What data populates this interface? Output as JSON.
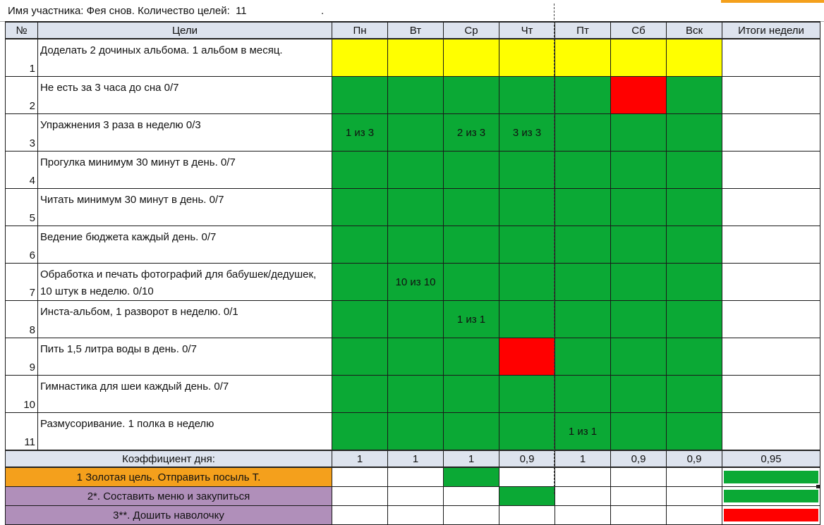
{
  "header": {
    "text": "Имя участника: Фея снов. Количество целей:  11",
    "dot": "."
  },
  "columns": [
    "№",
    "Цели",
    "Пн",
    "Вт",
    "Ср",
    "Чт",
    "Пт",
    "Сб",
    "Вск",
    "Итоги недели"
  ],
  "goals": [
    {
      "num": "1",
      "text": "Доделать 2 дочиных альбома. 1 альбом в месяц.",
      "days": [
        {
          "status": "yellow",
          "label": ""
        },
        {
          "status": "yellow",
          "label": ""
        },
        {
          "status": "yellow",
          "label": ""
        },
        {
          "status": "yellow",
          "label": ""
        },
        {
          "status": "yellow",
          "label": ""
        },
        {
          "status": "yellow",
          "label": ""
        },
        {
          "status": "yellow",
          "label": ""
        }
      ]
    },
    {
      "num": "2",
      "text": "Не есть за 3 часа до сна 0/7",
      "days": [
        {
          "status": "green",
          "label": ""
        },
        {
          "status": "green",
          "label": ""
        },
        {
          "status": "green",
          "label": ""
        },
        {
          "status": "green",
          "label": ""
        },
        {
          "status": "green",
          "label": ""
        },
        {
          "status": "red",
          "label": ""
        },
        {
          "status": "green",
          "label": ""
        }
      ]
    },
    {
      "num": "3",
      "text": "Упражнения 3 раза в неделю 0/3",
      "days": [
        {
          "status": "green",
          "label": "1 из 3"
        },
        {
          "status": "green",
          "label": ""
        },
        {
          "status": "green",
          "label": "2 из 3"
        },
        {
          "status": "green",
          "label": "3 из 3"
        },
        {
          "status": "green",
          "label": ""
        },
        {
          "status": "green",
          "label": ""
        },
        {
          "status": "green",
          "label": ""
        }
      ]
    },
    {
      "num": "4",
      "text": "Прогулка минимум 30 минут в день. 0/7",
      "days": [
        {
          "status": "green",
          "label": ""
        },
        {
          "status": "green",
          "label": ""
        },
        {
          "status": "green",
          "label": ""
        },
        {
          "status": "green",
          "label": ""
        },
        {
          "status": "green",
          "label": ""
        },
        {
          "status": "green",
          "label": ""
        },
        {
          "status": "green",
          "label": ""
        }
      ]
    },
    {
      "num": "5",
      "text": "Читать минимум 30 минут в день. 0/7",
      "days": [
        {
          "status": "green",
          "label": ""
        },
        {
          "status": "green",
          "label": ""
        },
        {
          "status": "green",
          "label": ""
        },
        {
          "status": "green",
          "label": ""
        },
        {
          "status": "green",
          "label": ""
        },
        {
          "status": "green",
          "label": ""
        },
        {
          "status": "green",
          "label": ""
        }
      ]
    },
    {
      "num": "6",
      "text": "Ведение бюджета каждый день.  0/7",
      "days": [
        {
          "status": "green",
          "label": ""
        },
        {
          "status": "green",
          "label": ""
        },
        {
          "status": "green",
          "label": ""
        },
        {
          "status": "green",
          "label": ""
        },
        {
          "status": "green",
          "label": ""
        },
        {
          "status": "green",
          "label": ""
        },
        {
          "status": "green",
          "label": ""
        }
      ]
    },
    {
      "num": "7",
      "text": "Обработка и печать фотографий для бабушек/дедушек, 10 штук в неделю. 0/10",
      "days": [
        {
          "status": "green",
          "label": ""
        },
        {
          "status": "green",
          "label": "10 из 10"
        },
        {
          "status": "green",
          "label": ""
        },
        {
          "status": "green",
          "label": ""
        },
        {
          "status": "green",
          "label": ""
        },
        {
          "status": "green",
          "label": ""
        },
        {
          "status": "green",
          "label": ""
        }
      ]
    },
    {
      "num": "8",
      "text": "Инста-альбом, 1 разворот в неделю. 0/1",
      "days": [
        {
          "status": "green",
          "label": ""
        },
        {
          "status": "green",
          "label": ""
        },
        {
          "status": "green",
          "label": "1 из 1"
        },
        {
          "status": "green",
          "label": ""
        },
        {
          "status": "green",
          "label": ""
        },
        {
          "status": "green",
          "label": ""
        },
        {
          "status": "green",
          "label": ""
        }
      ]
    },
    {
      "num": "9",
      "text": "Пить 1,5 литра воды в день. 0/7",
      "days": [
        {
          "status": "green",
          "label": ""
        },
        {
          "status": "green",
          "label": ""
        },
        {
          "status": "green",
          "label": ""
        },
        {
          "status": "red",
          "label": ""
        },
        {
          "status": "green",
          "label": ""
        },
        {
          "status": "green",
          "label": ""
        },
        {
          "status": "green",
          "label": ""
        }
      ]
    },
    {
      "num": "10",
      "text": "Гимнастика для шеи каждый день. 0/7",
      "days": [
        {
          "status": "green",
          "label": ""
        },
        {
          "status": "green",
          "label": ""
        },
        {
          "status": "green",
          "label": ""
        },
        {
          "status": "green",
          "label": ""
        },
        {
          "status": "green",
          "label": ""
        },
        {
          "status": "green",
          "label": ""
        },
        {
          "status": "green",
          "label": ""
        }
      ]
    },
    {
      "num": "11",
      "text": "Размусоривание. 1 полка в неделю",
      "days": [
        {
          "status": "green",
          "label": ""
        },
        {
          "status": "green",
          "label": ""
        },
        {
          "status": "green",
          "label": ""
        },
        {
          "status": "green",
          "label": ""
        },
        {
          "status": "green",
          "label": "1 из 1"
        },
        {
          "status": "green",
          "label": ""
        },
        {
          "status": "green",
          "label": ""
        }
      ]
    }
  ],
  "coefficient": {
    "label": "Коэффициент дня:",
    "values": [
      "1",
      "1",
      "1",
      "0,9",
      "1",
      "0,9",
      "0,9"
    ],
    "total": "0,95"
  },
  "special_goals": [
    {
      "label": "1 Золотая цель. Отправить посыль Т.",
      "color": "orange",
      "days": [
        "white",
        "white",
        "green",
        "white",
        "white",
        "white",
        "white"
      ],
      "total": "green"
    },
    {
      "label": "2*. Составить меню и закупиться",
      "color": "purple",
      "days": [
        "white",
        "white",
        "white",
        "green",
        "white",
        "white",
        "white"
      ],
      "total": "green"
    },
    {
      "label": "3**. Дошить наволочку",
      "color": "purple",
      "days": [
        "white",
        "white",
        "white",
        "white",
        "white",
        "white",
        "white"
      ],
      "total": "red"
    }
  ],
  "colors": {
    "green": "#0ba935",
    "yellow": "#ffff00",
    "red": "#ff0000",
    "orange": "#f4a01c",
    "purple": "#b08fba",
    "header": "#dde3ee"
  }
}
